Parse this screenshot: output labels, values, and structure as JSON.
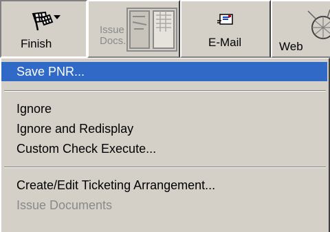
{
  "toolbar": {
    "finish": {
      "label": "Finish",
      "icon": "checkered-flag-icon"
    },
    "issue_docs": {
      "line1": "Issue",
      "line2": "Docs.",
      "icon": "document-icon"
    },
    "email": {
      "label": "E-Mail",
      "icon": "envelope-icon"
    },
    "web": {
      "label": "Web",
      "icon": "globe-icon"
    }
  },
  "menu": {
    "items": [
      {
        "label": "Save PNR...",
        "state": "highlighted"
      },
      {
        "label": "Ignore"
      },
      {
        "label": "Ignore and Redisplay"
      },
      {
        "label": "Custom Check Execute..."
      },
      {
        "label": "Create/Edit Ticketing Arrangement..."
      },
      {
        "label": "Issue Documents",
        "state": "disabled"
      }
    ]
  },
  "colors": {
    "face": "#d4d0c8",
    "highlight": "#3169c6",
    "disabled_text": "#8a8a8a"
  }
}
